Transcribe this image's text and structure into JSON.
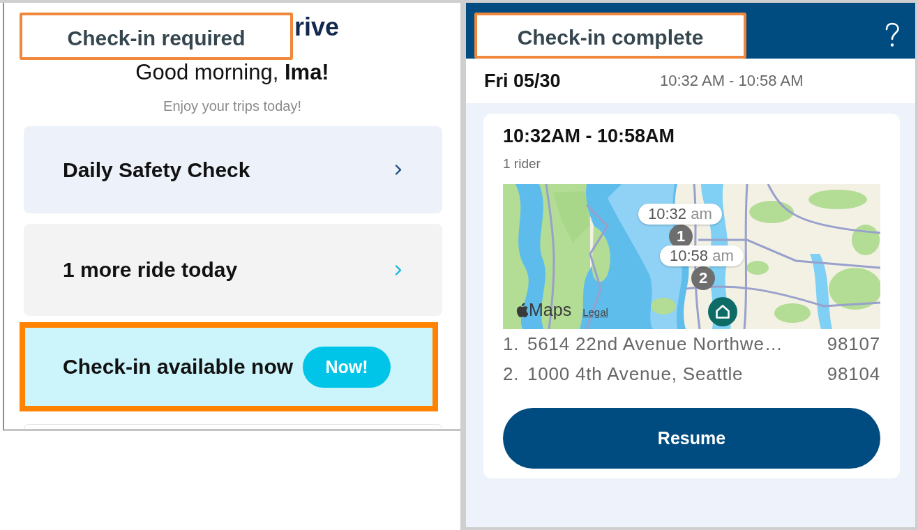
{
  "left_screen": {
    "annotation": {
      "label": "Check-in required"
    },
    "logo": {
      "text": "rive"
    },
    "greeting": "Good morning, **Ima!**",
    "subtitle": "Enjoy your trips today!",
    "cards": [
      {
        "kind": "task",
        "label": "Daily Safety Check",
        "highlighted": false
      },
      {
        "kind": "rides",
        "label": "1 more ride today",
        "highlighted": false
      },
      {
        "kind": "checkin",
        "label": "Check-in available now",
        "badge": "Now!",
        "highlighted": true
      }
    ]
  },
  "right_screen": {
    "annotation": {
      "label": "Check-in complete"
    },
    "date": "Fri 05/30",
    "time_range": "10:32 AM - 10:58 AM",
    "trip": {
      "time_range": "10:32AM - 10:58AM",
      "riders": "1 rider",
      "map": {
        "stops": [
          {
            "number": "1",
            "time": "10:32",
            "period": "am"
          },
          {
            "number": "2",
            "time": "10:58",
            "period": "am"
          }
        ],
        "attribution": "Maps",
        "legal_link": "Legal"
      },
      "addresses": [
        {
          "index": "1.",
          "address": "5614 22nd Avenue Northwe…",
          "zip": "98107"
        },
        {
          "index": "2.",
          "address": "1000 4th Avenue, Seattle",
          "zip": "98104"
        }
      ],
      "button": "Resume"
    }
  }
}
